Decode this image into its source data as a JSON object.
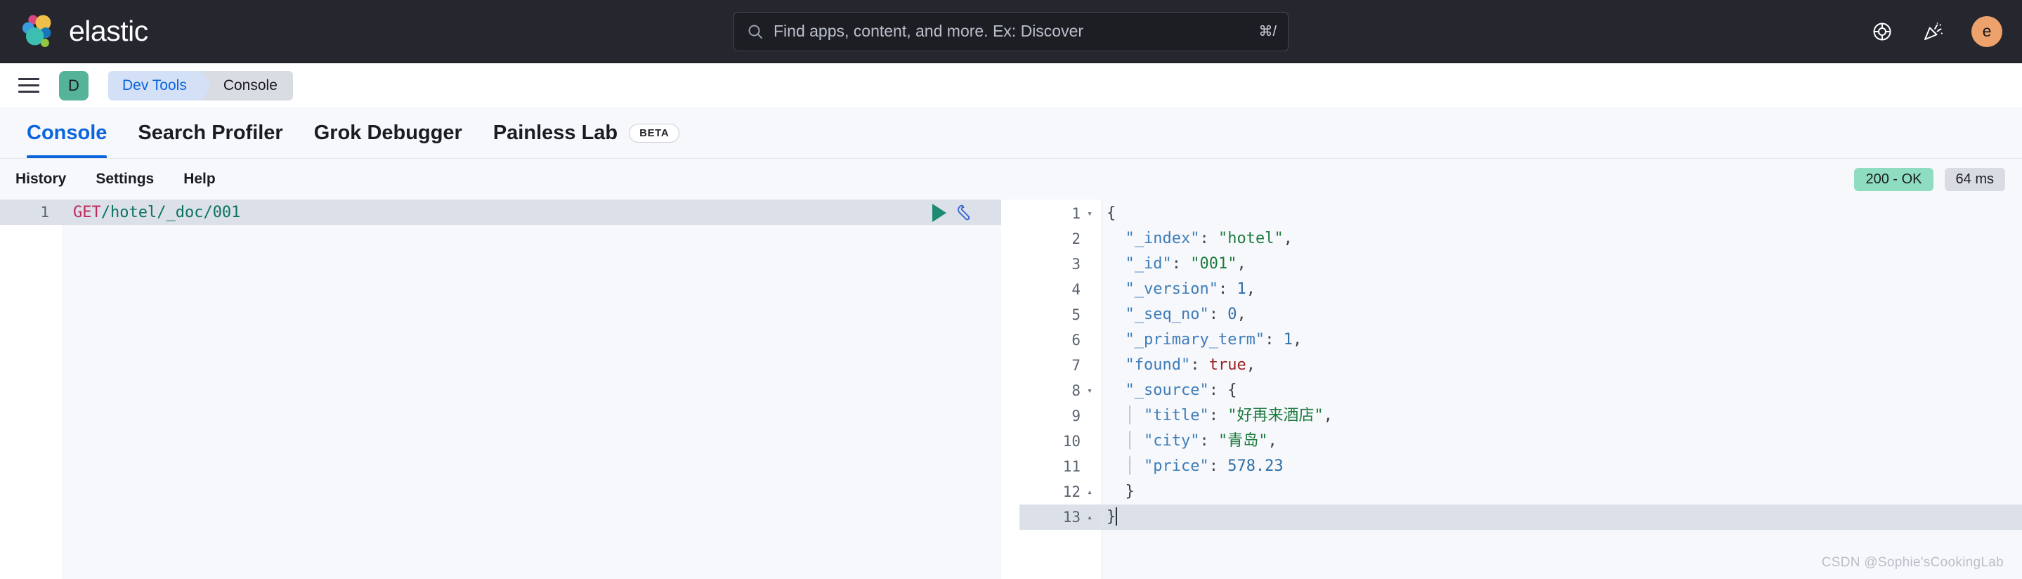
{
  "header": {
    "brand": "elastic",
    "logo_icon": "elastic-logo",
    "search": {
      "placeholder": "Find apps, content, and more. Ex: Discover",
      "value": "",
      "icon": "search-icon",
      "shortcut": "⌘/"
    },
    "actions": [
      {
        "icon": "help-life-ring-icon",
        "name": "help-menu"
      },
      {
        "icon": "news-announcement-icon",
        "name": "news-feed"
      }
    ],
    "avatar_initial": "e",
    "avatar_color": "#EEA26B"
  },
  "breadcrumb_bar": {
    "menu_icon": "hamburger-menu-icon",
    "space_initial": "D",
    "space_color": "#54B399",
    "crumbs": [
      {
        "label": "Dev Tools",
        "active": false
      },
      {
        "label": "Console",
        "active": true
      }
    ]
  },
  "tabs": [
    {
      "label": "Console",
      "active": true,
      "badge": ""
    },
    {
      "label": "Search Profiler",
      "active": false,
      "badge": ""
    },
    {
      "label": "Grok Debugger",
      "active": false,
      "badge": ""
    },
    {
      "label": "Painless Lab",
      "active": false,
      "badge": "BETA"
    }
  ],
  "console_toolbar": {
    "links": [
      "History",
      "Settings",
      "Help"
    ],
    "status_code": "200 - OK",
    "status_color": "#8FDDC0",
    "duration": "64 ms"
  },
  "request_editor": {
    "line_number": "1",
    "method": "GET",
    "path": "/hotel/_doc/001",
    "play_icon": "play-send-icon",
    "wrench_icon": "wrench-icon"
  },
  "response_editor": {
    "lines": [
      {
        "n": "1",
        "fold": "▾",
        "indent": 0,
        "current": false,
        "tokens": [
          {
            "t": "{",
            "c": "j-punc"
          }
        ]
      },
      {
        "n": "2",
        "fold": "",
        "indent": 1,
        "current": false,
        "tokens": [
          {
            "t": "\"_index\"",
            "c": "j-key"
          },
          {
            "t": ": ",
            "c": "j-punc"
          },
          {
            "t": "\"hotel\"",
            "c": "j-str"
          },
          {
            "t": ",",
            "c": "j-punc"
          }
        ]
      },
      {
        "n": "3",
        "fold": "",
        "indent": 1,
        "current": false,
        "tokens": [
          {
            "t": "\"_id\"",
            "c": "j-key"
          },
          {
            "t": ": ",
            "c": "j-punc"
          },
          {
            "t": "\"001\"",
            "c": "j-str"
          },
          {
            "t": ",",
            "c": "j-punc"
          }
        ]
      },
      {
        "n": "4",
        "fold": "",
        "indent": 1,
        "current": false,
        "tokens": [
          {
            "t": "\"_version\"",
            "c": "j-key"
          },
          {
            "t": ": ",
            "c": "j-punc"
          },
          {
            "t": "1",
            "c": "j-num"
          },
          {
            "t": ",",
            "c": "j-punc"
          }
        ]
      },
      {
        "n": "5",
        "fold": "",
        "indent": 1,
        "current": false,
        "tokens": [
          {
            "t": "\"_seq_no\"",
            "c": "j-key"
          },
          {
            "t": ": ",
            "c": "j-punc"
          },
          {
            "t": "0",
            "c": "j-num"
          },
          {
            "t": ",",
            "c": "j-punc"
          }
        ]
      },
      {
        "n": "6",
        "fold": "",
        "indent": 1,
        "current": false,
        "tokens": [
          {
            "t": "\"_primary_term\"",
            "c": "j-key"
          },
          {
            "t": ": ",
            "c": "j-punc"
          },
          {
            "t": "1",
            "c": "j-num"
          },
          {
            "t": ",",
            "c": "j-punc"
          }
        ]
      },
      {
        "n": "7",
        "fold": "",
        "indent": 1,
        "current": false,
        "tokens": [
          {
            "t": "\"found\"",
            "c": "j-key"
          },
          {
            "t": ": ",
            "c": "j-punc"
          },
          {
            "t": "true",
            "c": "j-bool"
          },
          {
            "t": ",",
            "c": "j-punc"
          }
        ]
      },
      {
        "n": "8",
        "fold": "▾",
        "indent": 1,
        "current": false,
        "tokens": [
          {
            "t": "\"_source\"",
            "c": "j-key"
          },
          {
            "t": ": ",
            "c": "j-punc"
          },
          {
            "t": "{",
            "c": "j-punc"
          }
        ]
      },
      {
        "n": "9",
        "fold": "",
        "indent": 2,
        "current": false,
        "guide": true,
        "tokens": [
          {
            "t": "\"title\"",
            "c": "j-key"
          },
          {
            "t": ": ",
            "c": "j-punc"
          },
          {
            "t": "\"好再来酒店\"",
            "c": "j-str"
          },
          {
            "t": ",",
            "c": "j-punc"
          }
        ]
      },
      {
        "n": "10",
        "fold": "",
        "indent": 2,
        "current": false,
        "guide": true,
        "tokens": [
          {
            "t": "\"city\"",
            "c": "j-key"
          },
          {
            "t": ": ",
            "c": "j-punc"
          },
          {
            "t": "\"青岛\"",
            "c": "j-str"
          },
          {
            "t": ",",
            "c": "j-punc"
          }
        ]
      },
      {
        "n": "11",
        "fold": "",
        "indent": 2,
        "current": false,
        "guide": true,
        "tokens": [
          {
            "t": "\"price\"",
            "c": "j-key"
          },
          {
            "t": ": ",
            "c": "j-punc"
          },
          {
            "t": "578.23",
            "c": "j-num"
          }
        ]
      },
      {
        "n": "12",
        "fold": "▴",
        "indent": 1,
        "current": false,
        "tokens": [
          {
            "t": "}",
            "c": "j-punc"
          }
        ]
      },
      {
        "n": "13",
        "fold": "▴",
        "indent": 0,
        "current": true,
        "caret": true,
        "tokens": [
          {
            "t": "}",
            "c": "j-punc"
          }
        ]
      }
    ]
  },
  "watermark": "CSDN @Sophie'sCookingLab"
}
